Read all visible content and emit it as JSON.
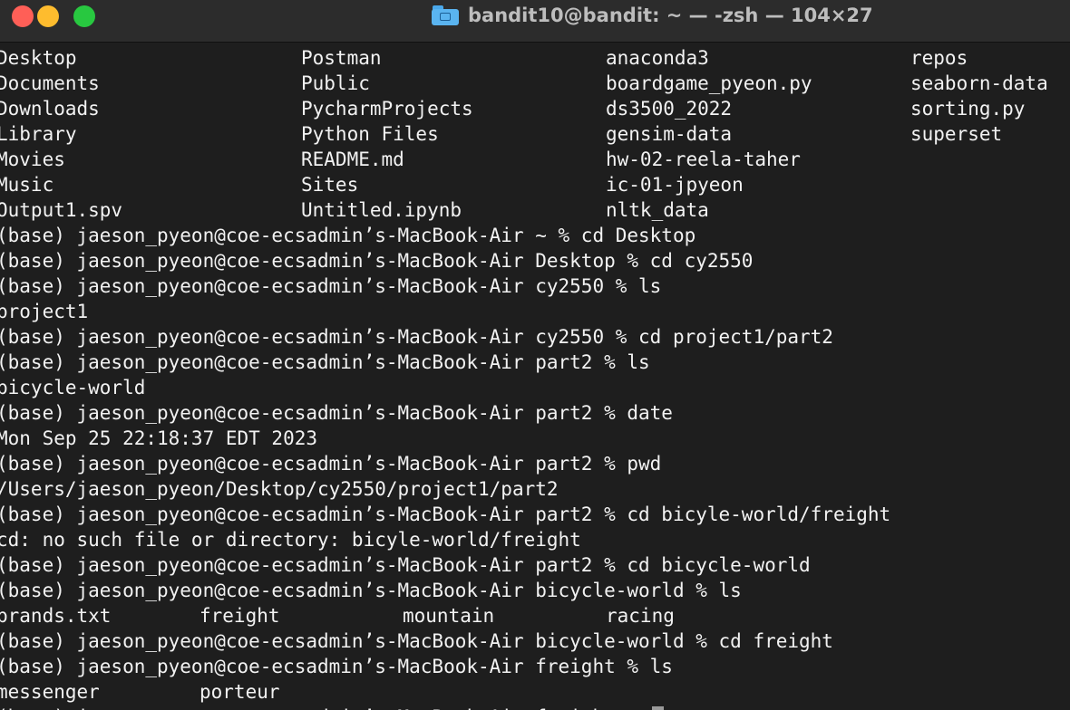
{
  "window": {
    "title": "bandit10@bandit: ~ — -zsh — 104×27",
    "title_icon": "folder-icon",
    "traffic_lights": {
      "close": "#ff5f57",
      "minimize": "#febc2e",
      "zoom": "#28c840"
    }
  },
  "terminal": {
    "ls_home": [
      [
        "Desktop",
        "Postman",
        "anaconda3",
        "repos"
      ],
      [
        "Documents",
        "Public",
        "boardgame_pyeon.py",
        "seaborn-data"
      ],
      [
        "Downloads",
        "PycharmProjects",
        "ds3500_2022",
        "sorting.py"
      ],
      [
        "Library",
        "Python Files",
        "gensim-data",
        "superset"
      ],
      [
        "Movies",
        "README.md",
        "hw-02-reela-taher",
        ""
      ],
      [
        "Music",
        "Sites",
        "ic-01-jpyeon",
        ""
      ],
      [
        "Output1.spv",
        "Untitled.ipynb",
        "nltk_data",
        ""
      ]
    ],
    "lines": [
      "(base) jaeson_pyeon@coe-ecsadmin’s-MacBook-Air ~ % cd Desktop",
      "(base) jaeson_pyeon@coe-ecsadmin’s-MacBook-Air Desktop % cd cy2550",
      "(base) jaeson_pyeon@coe-ecsadmin’s-MacBook-Air cy2550 % ls",
      "project1",
      "(base) jaeson_pyeon@coe-ecsadmin’s-MacBook-Air cy2550 % cd project1/part2",
      "(base) jaeson_pyeon@coe-ecsadmin’s-MacBook-Air part2 % ls",
      "bicycle-world",
      "(base) jaeson_pyeon@coe-ecsadmin’s-MacBook-Air part2 % date",
      "Mon Sep 25 22:18:37 EDT 2023",
      "(base) jaeson_pyeon@coe-ecsadmin’s-MacBook-Air part2 % pwd",
      "/Users/jaeson_pyeon/Desktop/cy2550/project1/part2",
      "(base) jaeson_pyeon@coe-ecsadmin’s-MacBook-Air part2 % cd bicyle-world/freight",
      "cd: no such file or directory: bicyle-world/freight",
      "(base) jaeson_pyeon@coe-ecsadmin’s-MacBook-Air part2 % cd bicycle-world",
      "(base) jaeson_pyeon@coe-ecsadmin’s-MacBook-Air bicycle-world % ls"
    ],
    "ls_bicycle_world": [
      "brands.txt",
      "freight",
      "mountain",
      "racing"
    ],
    "lines2": [
      "(base) jaeson_pyeon@coe-ecsadmin’s-MacBook-Air bicycle-world % cd freight",
      "(base) jaeson_pyeon@coe-ecsadmin’s-MacBook-Air freight % ls"
    ],
    "ls_freight": [
      "messenger",
      "porteur"
    ],
    "prompt": "(base) jaeson_pyeon@coe-ecsadmin’s-MacBook-Air freight % "
  }
}
